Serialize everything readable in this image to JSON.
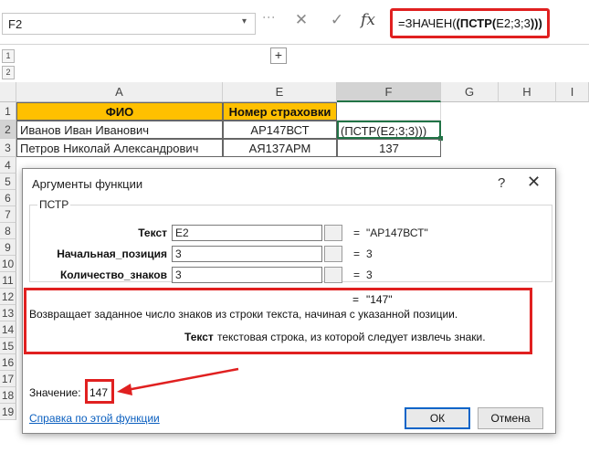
{
  "formula_bar": {
    "name_box": "F2",
    "cancel_icon": "✕",
    "enter_icon": "✓",
    "fx_icon": "fx",
    "formula_prefix": "=ЗНАЧЕН(",
    "formula_bold": "(ПСТР(",
    "formula_args": "E2;3;3",
    "formula_suffix": ")))"
  },
  "outline": {
    "levels": [
      "1",
      "2"
    ],
    "expand": "+"
  },
  "columns": [
    "A",
    "E",
    "F",
    "G",
    "H",
    "I"
  ],
  "rows": [
    "1",
    "2",
    "3",
    "4",
    "5",
    "6",
    "7",
    "8",
    "9",
    "10",
    "11",
    "12",
    "13",
    "14",
    "15",
    "16",
    "17",
    "18",
    "19"
  ],
  "table": {
    "headers": [
      "ФИО",
      "Номер страховки",
      ""
    ],
    "rows": [
      [
        "Иванов Иван Иванович",
        "АР147ВСТ",
        "(ПСТР(E2;3;3)))"
      ],
      [
        "Петров Николай Александрович",
        "АЯ137АРМ",
        "137"
      ]
    ]
  },
  "dialog": {
    "title": "Аргументы функции",
    "help": "?",
    "close": "✕",
    "function_name": "ПСТР",
    "args": [
      {
        "label": "Текст",
        "value": "E2",
        "result": "\"АР147ВСТ\""
      },
      {
        "label": "Начальная_позиция",
        "value": "3",
        "result": "3"
      },
      {
        "label": "Количество_знаков",
        "value": "3",
        "result": "3"
      }
    ],
    "eq": "=",
    "overall_result": "\"147\"",
    "description": "Возвращает заданное число знаков из строки текста, начиная с указанной позиции.",
    "arg_help_name": "Текст",
    "arg_help_text": "текстовая строка, из которой следует извлечь знаки.",
    "value_label": "Значение:",
    "value": "147",
    "help_link": "Справка по этой функции",
    "ok": "ОК",
    "cancel": "Отмена"
  },
  "colors": {
    "header_fill": "#ffc000",
    "annotation": "#e02020",
    "link": "#0b5fbf",
    "selection": "#217346"
  }
}
